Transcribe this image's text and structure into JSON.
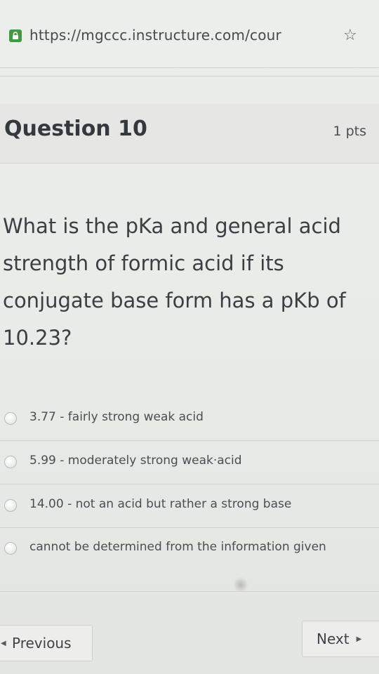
{
  "browser": {
    "url": "https://mgccc.instructure.com/cour",
    "icons": [
      "lock-icon",
      "star-icon"
    ]
  },
  "question": {
    "title": "Question 10",
    "points": "1 pts",
    "text": "What is the pKa and general acid strength of formic acid if its conjugate base form has a pKb of 10.23?"
  },
  "answers": [
    {
      "label": "3.77 - fairly strong weak acid",
      "selected": false
    },
    {
      "label": "5.99 - moderately strong weak·acid",
      "selected": false
    },
    {
      "label": "14.00 - not an acid but rather a strong base",
      "selected": false
    },
    {
      "label": "cannot be determined from the information given",
      "selected": false
    }
  ],
  "nav": {
    "previous_label": "Previous",
    "next_label": "Next"
  },
  "colors": {
    "lock": "#3f9a44",
    "background": "#e9ebe8"
  }
}
